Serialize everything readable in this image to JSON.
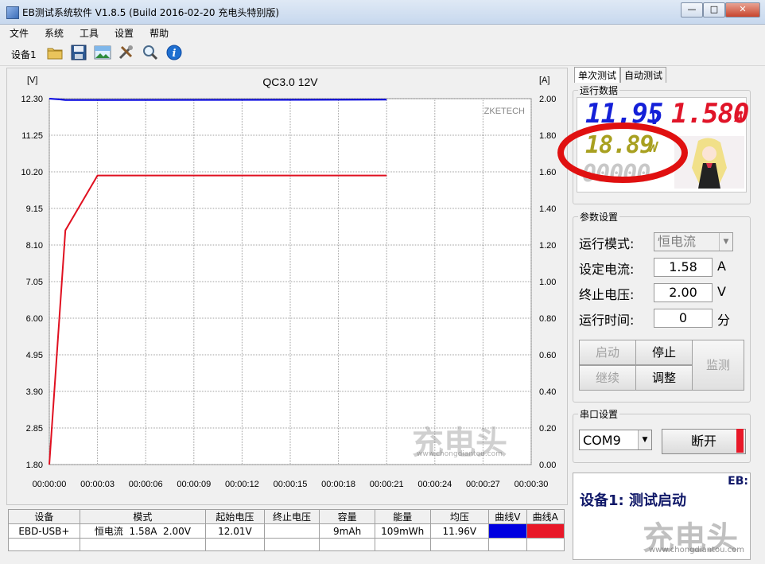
{
  "window": {
    "title": "EB测试系统软件 V1.8.5 (Build 2016-02-20 充电头特别版)"
  },
  "menu": [
    "文件",
    "系统",
    "工具",
    "设置",
    "帮助"
  ],
  "toolbar": {
    "device_tab": "设备1",
    "icons": [
      "open-folder-icon",
      "save-icon",
      "picture-icon",
      "tools-icon",
      "search-icon",
      "info-icon"
    ]
  },
  "chart_data": {
    "type": "line",
    "title": "QC3.0 12V",
    "watermark": "ZKETECH",
    "left_unit": "[V]",
    "right_unit": "[A]",
    "left_ticks": [
      "12.30",
      "11.25",
      "10.20",
      "9.15",
      "8.10",
      "7.05",
      "6.00",
      "4.95",
      "3.90",
      "2.85",
      "1.80"
    ],
    "right_ticks": [
      "2.00",
      "1.80",
      "1.60",
      "1.40",
      "1.20",
      "1.00",
      "0.80",
      "0.60",
      "0.40",
      "0.20",
      "0.00"
    ],
    "x_ticks": [
      "00:00:00",
      "00:00:03",
      "00:00:06",
      "00:00:09",
      "00:00:12",
      "00:00:15",
      "00:00:18",
      "00:00:21",
      "00:00:24",
      "00:00:27",
      "00:00:30"
    ],
    "ylim_v": [
      1.8,
      12.3
    ],
    "ylim_a": [
      0.0,
      2.0
    ],
    "xlim_s": [
      0,
      30
    ],
    "series": [
      {
        "name": "曲线V",
        "color": "#0000e0",
        "axis": "V",
        "points": [
          [
            0,
            12.3
          ],
          [
            0.6,
            12.28
          ],
          [
            1,
            12.26
          ],
          [
            3,
            12.26
          ],
          [
            21,
            12.27
          ]
        ]
      },
      {
        "name": "曲线A",
        "color": "#e01020",
        "axis": "A",
        "points": [
          [
            0,
            0.0
          ],
          [
            1,
            1.28
          ],
          [
            3,
            1.58
          ],
          [
            21,
            1.58
          ]
        ]
      }
    ],
    "grid": true
  },
  "status_table": {
    "headers": [
      "设备",
      "模式",
      "起始电压",
      "终止电压",
      "容量",
      "能量",
      "均压",
      "曲线V",
      "曲线A"
    ],
    "row": [
      "EBD-USB+",
      "恒电流  1.58A  2.00V",
      "12.01V",
      "",
      "9mAh",
      "109mWh",
      "11.96V",
      "",
      ""
    ],
    "swatch_v": "#0000e0",
    "swatch_a": "#e81828"
  },
  "tabs": [
    "单次测试",
    "自动测试"
  ],
  "running_data": {
    "label": "运行数据",
    "voltage": "11.95",
    "voltage_unit": "V",
    "current": "1.580",
    "current_unit": "A",
    "power": "18.89",
    "power_unit": "W",
    "energy_placeholder": "00000"
  },
  "params": {
    "label": "参数设置",
    "mode_label": "运行模式:",
    "mode_value": "恒电流",
    "current_label": "设定电流:",
    "current_value": "1.58",
    "current_unit": "A",
    "voltage_label": "终止电压:",
    "voltage_value": "2.00",
    "voltage_unit": "V",
    "time_label": "运行时间:",
    "time_value": "0",
    "time_unit": "分",
    "buttons": {
      "start": "启动",
      "stop": "停止",
      "monitor": "监测",
      "continue": "继续",
      "adjust": "调整"
    }
  },
  "serial": {
    "label": "串口设置",
    "port": "COM9",
    "disconnect": "断开"
  },
  "status": {
    "message": "设备1: 测试启动",
    "corner": "EB:"
  },
  "brand_watermark": {
    "big": "充电头",
    "small": "www.chongdiantou.com"
  }
}
